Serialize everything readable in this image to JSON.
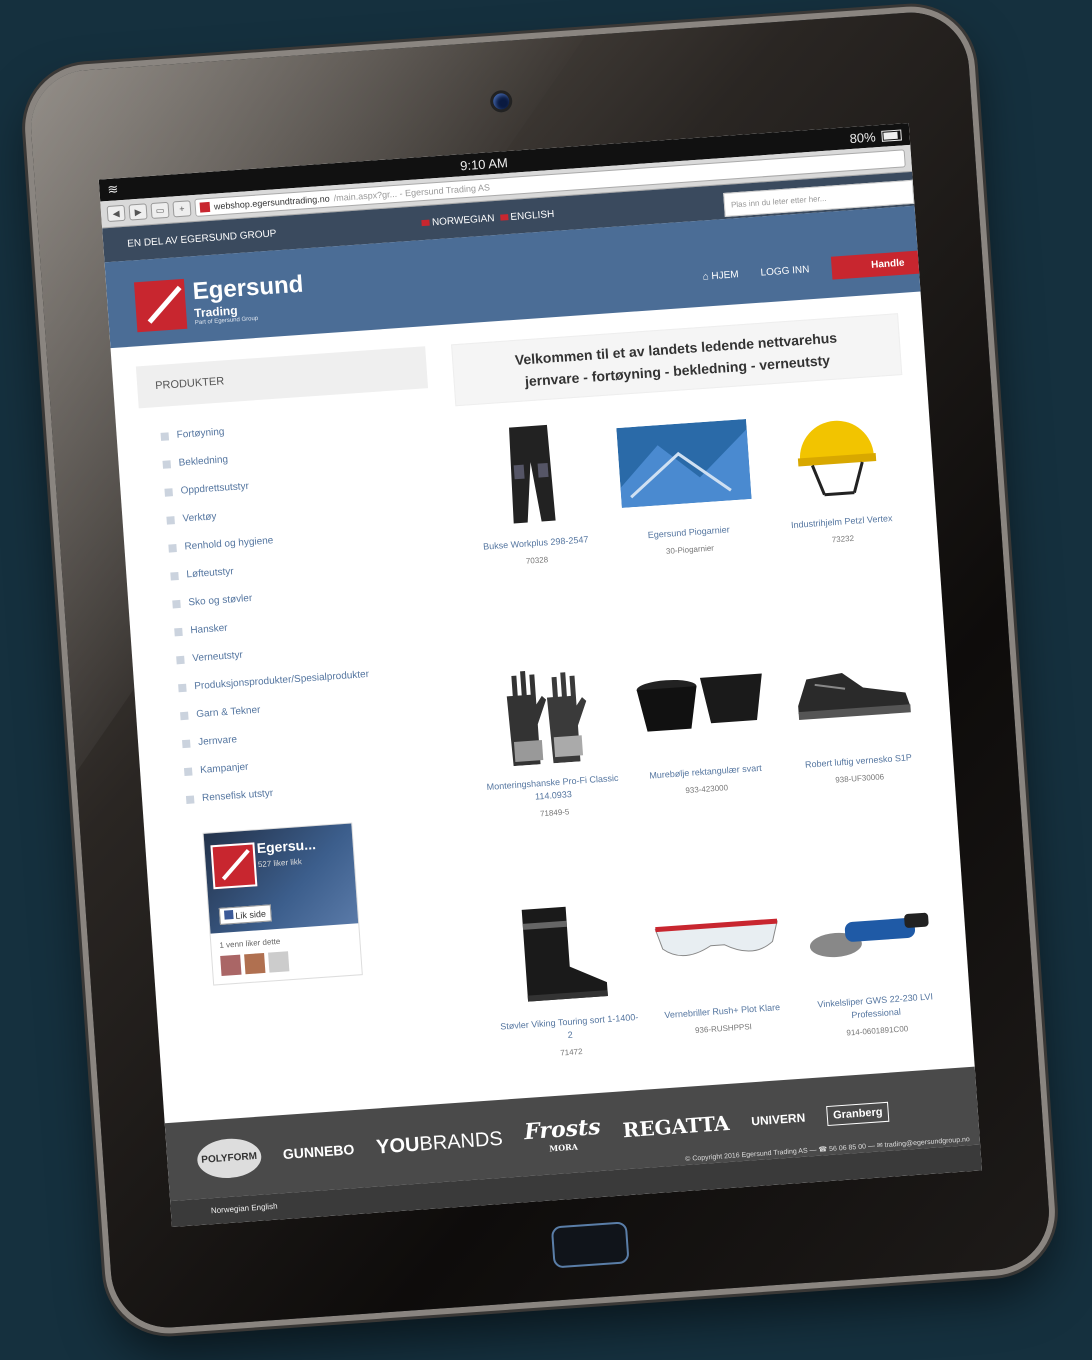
{
  "status": {
    "time": "9:10 AM",
    "battery": "80%"
  },
  "browser": {
    "url": "webshop.egersundtrading.no",
    "url_rest": "/main.aspx?gr... - Egersund Trading AS"
  },
  "topbar": {
    "group": "EN DEL AV EGERSUND GROUP",
    "lang_no": "NORWEGIAN",
    "lang_en": "ENGLISH",
    "search_placeholder": "Plas inn du leter etter her..."
  },
  "header": {
    "brand": "Egersund",
    "sub": "Trading",
    "tagline": "Part of Egersund Group",
    "home": "HJEM",
    "login": "LOGG INN",
    "cart": "Handle"
  },
  "sidebar": {
    "title": "PRODUKTER",
    "items": [
      "Fortøyning",
      "Bekledning",
      "Oppdrettsutstyr",
      "Verktøy",
      "Renhold og hygiene",
      "Løfteutstyr",
      "Sko og støvler",
      "Hansker",
      "Verneutstyr",
      "Produksjonsprodukter/Spesialprodukter",
      "Garn & Tekner",
      "Jernvare",
      "Kampanjer",
      "Rensefisk utstyr"
    ]
  },
  "facebook": {
    "name": "Egersu...",
    "likes": "527 liker likk",
    "like": "Lik side",
    "friends": "1 venn liker dette"
  },
  "welcome": {
    "line1": "Velkommen til et av landets ledende nettvarehus",
    "line2": "jernvare - fortøyning - bekledning - verneutsty"
  },
  "products": [
    {
      "name": "Bukse Workplus 298-2547",
      "code": "70328"
    },
    {
      "name": "Egersund Piogarnier",
      "code": "30-Piogarnier"
    },
    {
      "name": "Industrihjelm Petzl Vertex",
      "code": "73232"
    },
    {
      "name": "Monteringshanske Pro-Fi Classic 114.0933",
      "code": "71849-5"
    },
    {
      "name": "Murebølje rektangulær svart",
      "code": "933-423000"
    },
    {
      "name": "Robert luftig vernesko S1P",
      "code": "938-UF30006"
    },
    {
      "name": "Støvler Viking Touring sort 1-1400-2",
      "code": "71472"
    },
    {
      "name": "Vernebriller Rush+ Plot Klare",
      "code": "936-RUSHPPSI"
    },
    {
      "name": "Vinkelsliper GWS 22-230 LVI Professional",
      "code": "914-0601891C00"
    }
  ],
  "footer": {
    "brands": [
      "POLYFORM",
      "GUNNEBO",
      "YOU",
      "BRANDS",
      "Frosts",
      "MORA",
      "REGATTA",
      "UNIVERN",
      "Granberg"
    ],
    "copyright": "© Copyright 2016 Egersund Trading AS — ☎ 56 06 85 00 — ✉ trading@egersundgroup.no",
    "lang": "Norwegian  English"
  }
}
